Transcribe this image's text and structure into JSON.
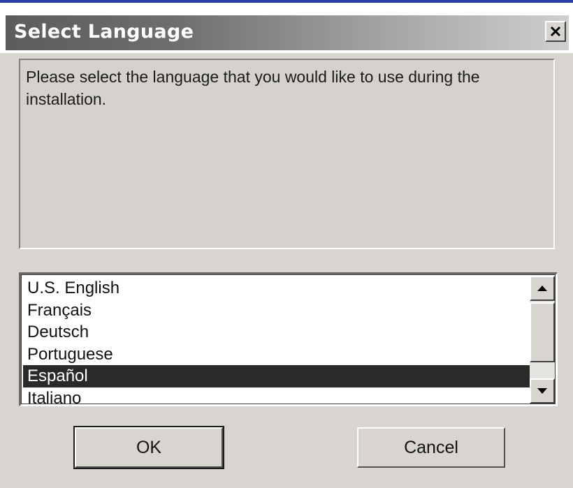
{
  "dialog": {
    "title": "Select Language",
    "close_icon": "close-icon",
    "prompt": "Please select the language that you would like to use during the installation."
  },
  "language_list": {
    "items": [
      {
        "label": "U.S. English",
        "selected": false
      },
      {
        "label": "Français",
        "selected": false
      },
      {
        "label": "Deutsch",
        "selected": false
      },
      {
        "label": "Portuguese",
        "selected": false
      },
      {
        "label": "Español",
        "selected": true
      },
      {
        "label": "Italiano",
        "selected": false
      }
    ],
    "selected_value": "Español"
  },
  "buttons": {
    "ok_label": "OK",
    "cancel_label": "Cancel"
  },
  "colors": {
    "accent_bar": "#2a3fa8",
    "selection": "#2a2a2a",
    "dialog_face": "#d8d5d1"
  }
}
